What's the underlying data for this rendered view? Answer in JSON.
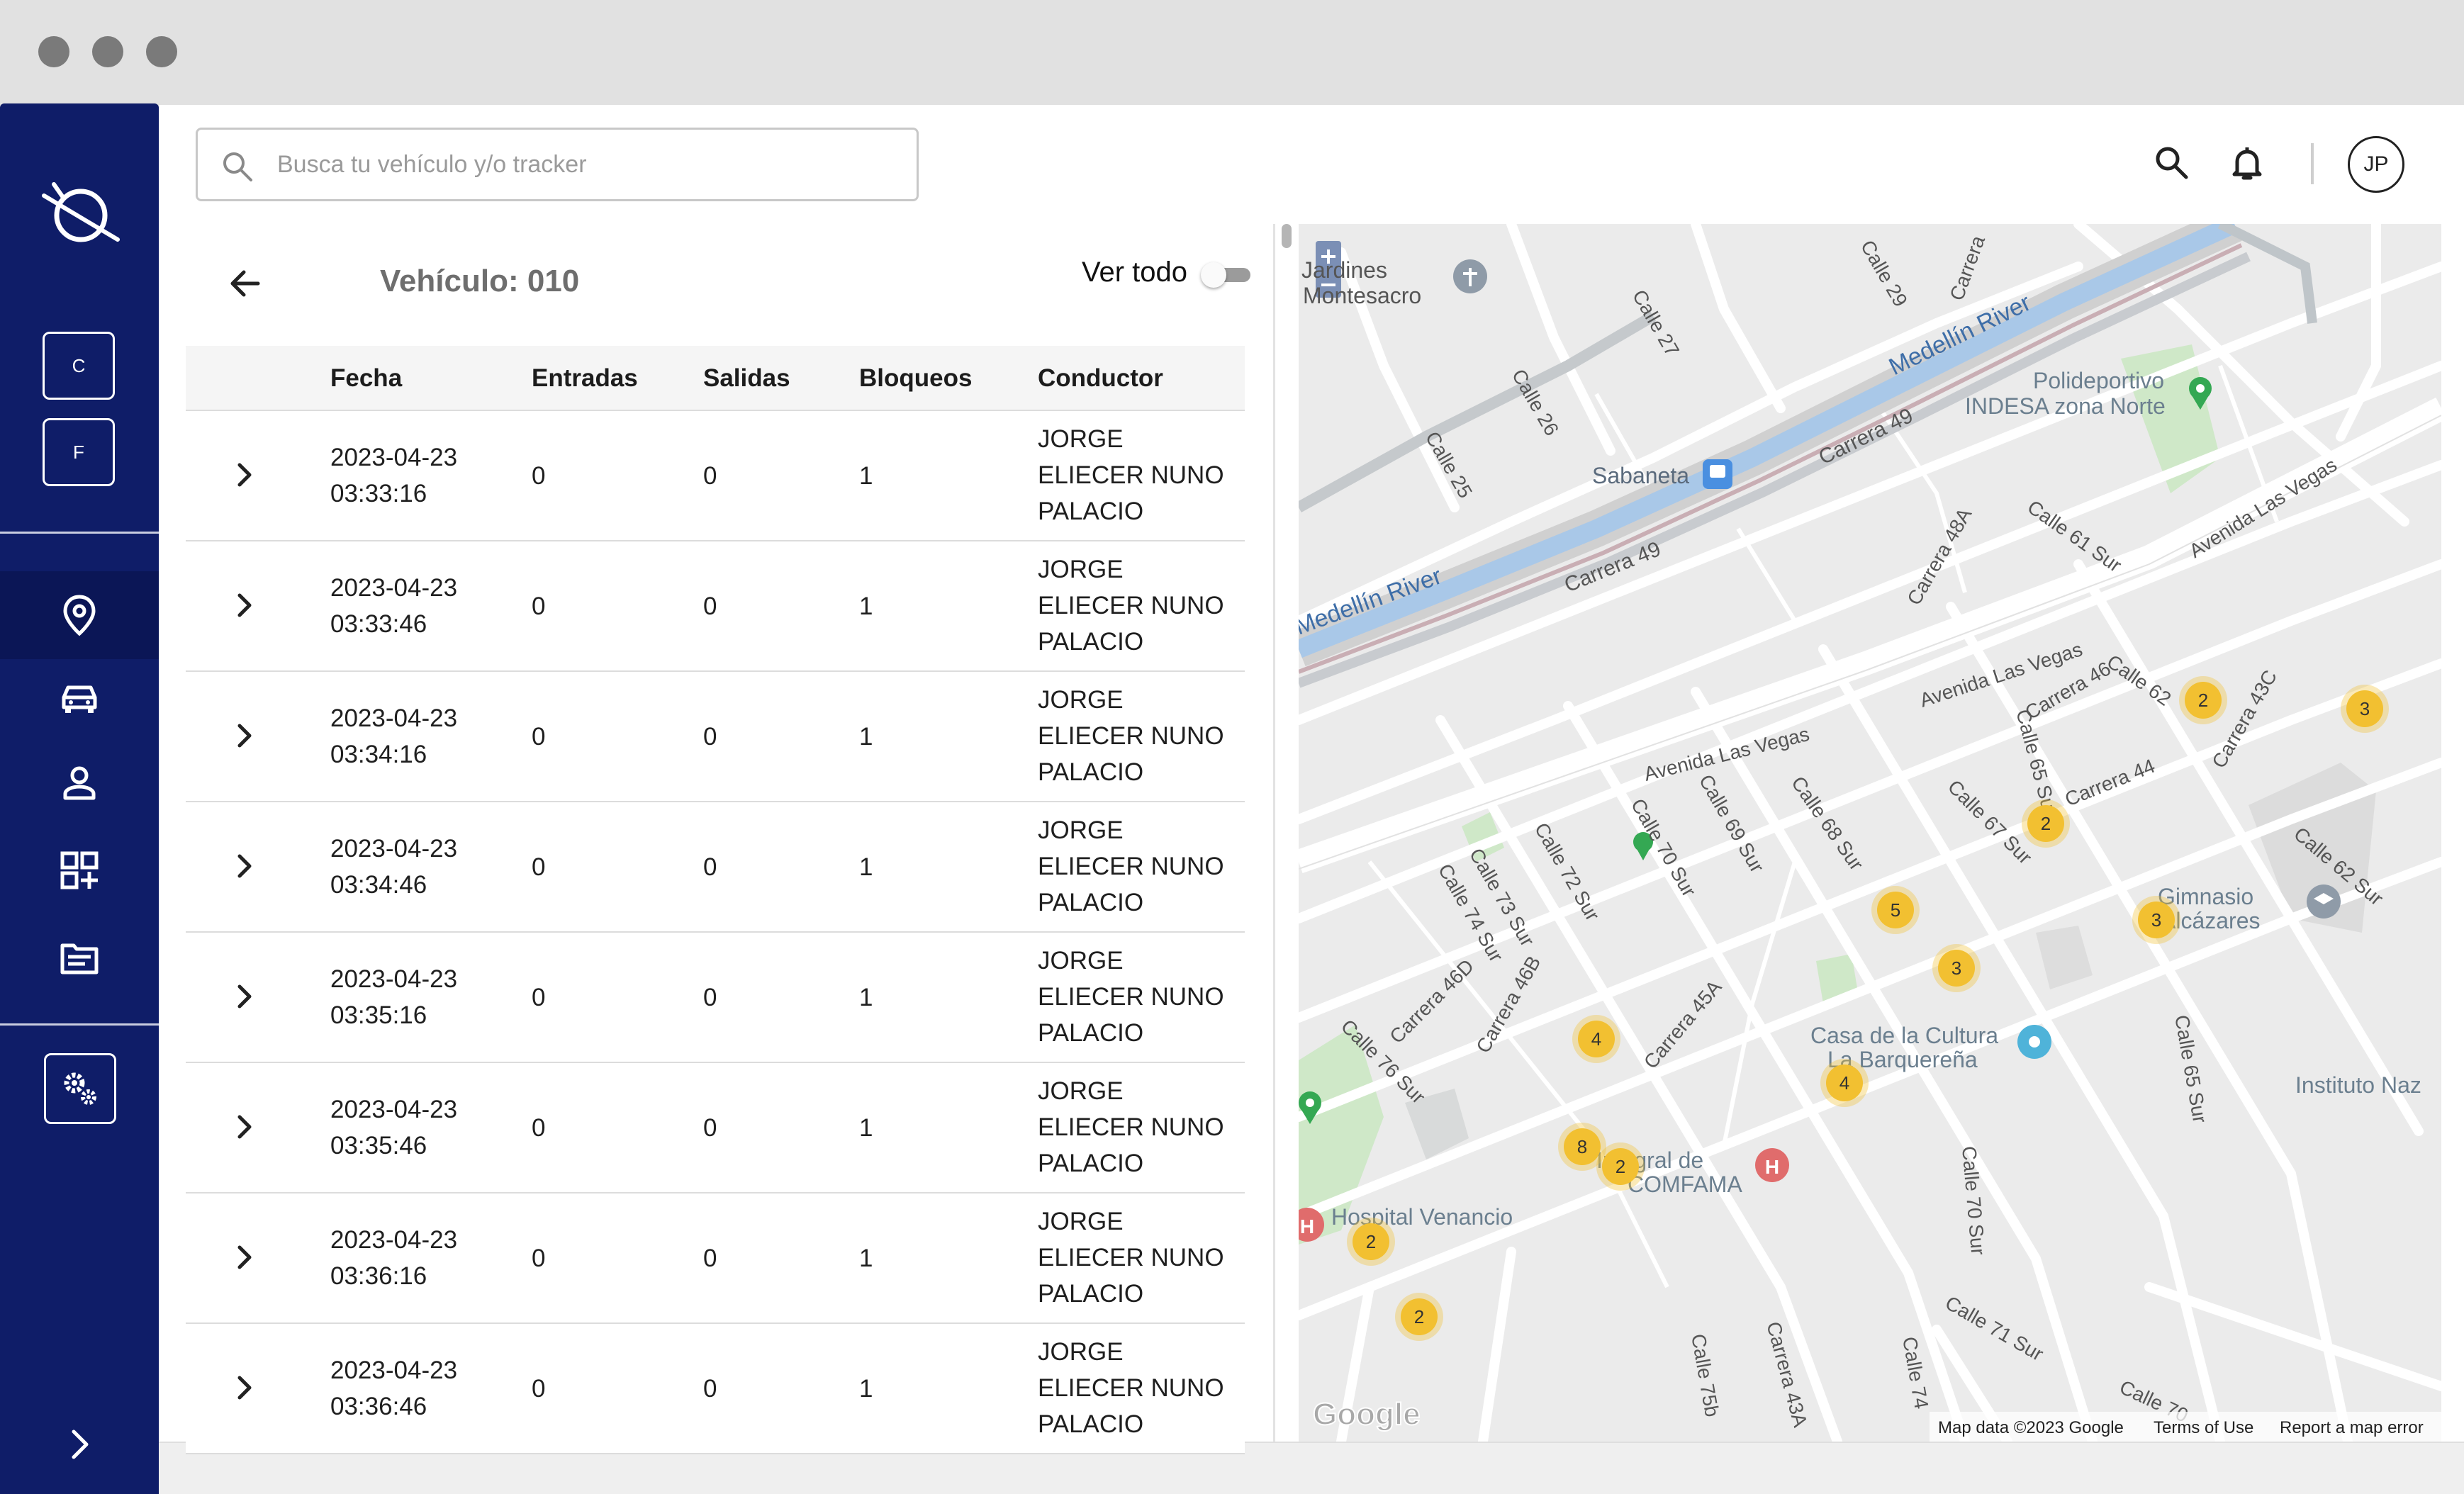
{
  "search": {
    "placeholder": "Busca tu vehículo y/o tracker"
  },
  "header": {
    "avatar_initials": "JP"
  },
  "sidebar": {
    "company_buttons": [
      {
        "label": "C"
      },
      {
        "label": "F"
      }
    ],
    "nav_items": [
      {
        "icon": "location-pin-icon",
        "active": true
      },
      {
        "icon": "car-icon",
        "active": false
      },
      {
        "icon": "person-icon",
        "active": false
      },
      {
        "icon": "add-widget-icon",
        "active": false
      },
      {
        "icon": "document-list-icon",
        "active": false
      }
    ],
    "settings_icon": "settings-gears-icon",
    "accent_color": "#0f1d68"
  },
  "panel": {
    "title": "Vehículo: 010",
    "toggle_label": "Ver todo",
    "toggle_on": false
  },
  "table": {
    "columns": [
      "Fecha",
      "Entradas",
      "Salidas",
      "Bloqueos",
      "Conductor"
    ],
    "rows": [
      {
        "date": "2023-04-23",
        "time": "03:33:16",
        "entradas": "0",
        "salidas": "0",
        "bloqueos": "1",
        "conductor": [
          "JORGE",
          "ELIECER NUNO",
          "PALACIO"
        ]
      },
      {
        "date": "2023-04-23",
        "time": "03:33:46",
        "entradas": "0",
        "salidas": "0",
        "bloqueos": "1",
        "conductor": [
          "JORGE",
          "ELIECER NUNO",
          "PALACIO"
        ]
      },
      {
        "date": "2023-04-23",
        "time": "03:34:16",
        "entradas": "0",
        "salidas": "0",
        "bloqueos": "1",
        "conductor": [
          "JORGE",
          "ELIECER NUNO",
          "PALACIO"
        ]
      },
      {
        "date": "2023-04-23",
        "time": "03:34:46",
        "entradas": "0",
        "salidas": "0",
        "bloqueos": "1",
        "conductor": [
          "JORGE",
          "ELIECER NUNO",
          "PALACIO"
        ]
      },
      {
        "date": "2023-04-23",
        "time": "03:35:16",
        "entradas": "0",
        "salidas": "0",
        "bloqueos": "1",
        "conductor": [
          "JORGE",
          "ELIECER NUNO",
          "PALACIO"
        ]
      },
      {
        "date": "2023-04-23",
        "time": "03:35:46",
        "entradas": "0",
        "salidas": "0",
        "bloqueos": "1",
        "conductor": [
          "JORGE",
          "ELIECER NUNO",
          "PALACIO"
        ]
      },
      {
        "date": "2023-04-23",
        "time": "03:36:16",
        "entradas": "0",
        "salidas": "0",
        "bloqueos": "1",
        "conductor": [
          "JORGE",
          "ELIECER NUNO",
          "PALACIO"
        ]
      },
      {
        "date": "2023-04-23",
        "time": "03:36:46",
        "entradas": "0",
        "salidas": "0",
        "bloqueos": "1",
        "conductor": [
          "JORGE",
          "ELIECER NUNO",
          "PALACIO"
        ]
      }
    ]
  },
  "map": {
    "labels": {
      "jardines": "Jardines",
      "montesacro": "Montesacro",
      "polideportivo": "Polideportivo",
      "indesa": "INDESA zona Norte",
      "sabaneta": "Sabaneta",
      "medellin_river_1": "Medellín River",
      "medellin_river_2": "Medellín River",
      "carrera_49_1": "Carrera 49",
      "carrera_49_2": "Carrera 49",
      "avenida_las_vegas_1": "Avenida Las Vegas",
      "avenida_las_vegas_2": "Avenida Las Vegas",
      "avenida_las_vegas_3": "Avenida Las Vegas",
      "calle_29": "Calle 29",
      "calle_27": "Calle 27",
      "calle_26": "Calle 26",
      "calle_25": "Calle 25",
      "carrera": "Carrera",
      "carrera_48a": "Carrera 48A",
      "calle_61_sur": "Calle 61 Sur",
      "calle_62": "Calle 62",
      "carrera_46": "Carrera 46",
      "carrera_43c": "Carrera 43C",
      "calle_65_sur": "Calle 65 Sur",
      "carrera_44": "Carrera 44",
      "calle_67_sur": "Calle 67 Sur",
      "calle_68_sur": "Calle 68 Sur",
      "calle_69_sur": "Calle 69 Sur",
      "calle_70_sur": "Calle 70 Sur",
      "calle_72_sur": "Calle 72 Sur",
      "calle_73_sur": "Calle 73 Sur",
      "calle_74_sur": "Calle 74 Sur",
      "calle_76_sur": "Calle 76 Sur",
      "carrera_46d": "Carrera 46D",
      "carrera_46b": "Carrera 46B",
      "carrera_45a": "Carrera 45A",
      "calle_62_sur": "Calle 62 Sur",
      "gimnasio": "Gimnasio",
      "alcazares": "Alcázares",
      "casa_cultura": "Casa de la Cultura",
      "barquerena": "La Barquereña",
      "instituto": "Instituto Naz",
      "hospital_venancio": "Hospital Venancio",
      "integral_de": "Integral de",
      "comfama": "COMFAMA",
      "calle_70_sur_b": "Calle 70 Sur",
      "calle_71_sur": "Calle 71 Sur",
      "calle_65_sur_b": "Calle 65 Sur",
      "carrera_43a": "Carrera 43A",
      "calle_75b": "Calle 75b",
      "calle_74": "Calle 74",
      "calle_70": "Calle 70",
      "google": "Google",
      "map_data": "Map data ©2023 Google",
      "terms": "Terms of Use",
      "report": "Report a map error"
    },
    "clusters": [
      {
        "count": "2"
      },
      {
        "count": "3"
      },
      {
        "count": "2"
      },
      {
        "count": "5"
      },
      {
        "count": "3"
      },
      {
        "count": "3"
      },
      {
        "count": "4"
      },
      {
        "count": "4"
      },
      {
        "count": "8"
      },
      {
        "count": "2"
      },
      {
        "count": "2"
      },
      {
        "count": "2"
      }
    ],
    "cluster_color": "#f2c031"
  }
}
